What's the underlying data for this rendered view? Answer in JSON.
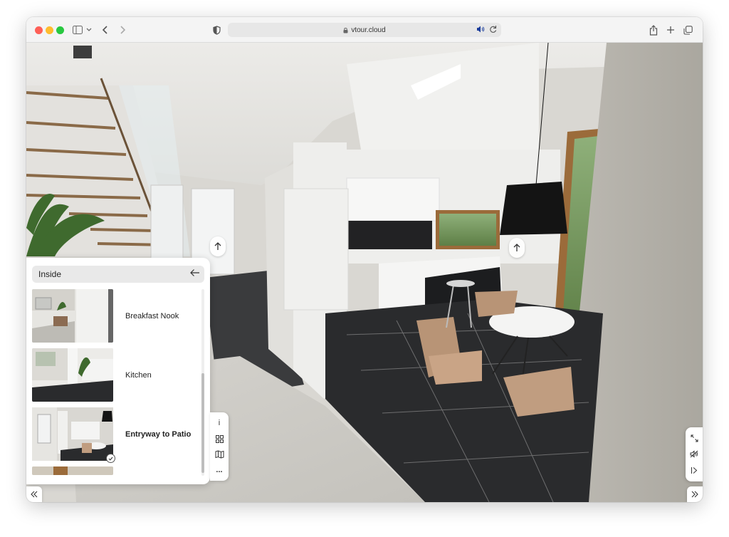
{
  "browser": {
    "url": "vtour.cloud",
    "icons": [
      "sidebar-icon",
      "chevron-down-icon",
      "back-icon",
      "forward-icon",
      "shield-icon",
      "lock-icon",
      "speaker-icon",
      "reload-icon",
      "share-icon",
      "plus-icon",
      "tabs-icon"
    ]
  },
  "panel": {
    "title": "Inside",
    "items": [
      {
        "label": "Breakfast Nook",
        "active": false
      },
      {
        "label": "Kitchen",
        "active": false
      },
      {
        "label": "Entryway to Patio",
        "active": true
      }
    ]
  },
  "tools": {
    "info_label": "i",
    "more_label": "..."
  },
  "colors": {
    "panel_bg": "#ffffff",
    "active_text": "#111111",
    "toolbar_bg": "#f4f4f4"
  }
}
